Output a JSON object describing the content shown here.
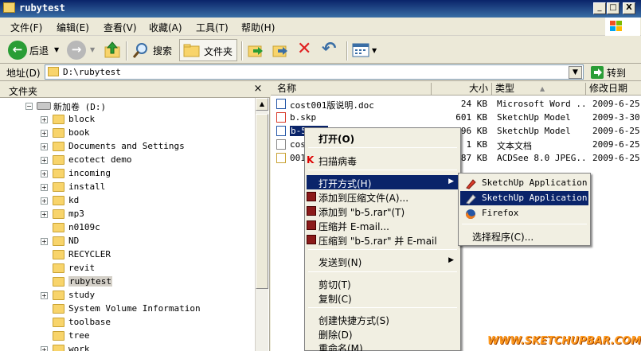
{
  "window": {
    "title": "rubytest",
    "controls": {
      "minimize": "_",
      "maximize": "□",
      "close": "X"
    }
  },
  "menubar": {
    "items": [
      "文件(F)",
      "编辑(E)",
      "查看(V)",
      "收藏(A)",
      "工具(T)",
      "帮助(H)"
    ]
  },
  "toolbar": {
    "back_label": "后退",
    "search_label": "搜索",
    "folders_label": "文件夹"
  },
  "address": {
    "label": "地址(D)",
    "value": "D:\\rubytest",
    "go_label": "转到"
  },
  "folder_pane": {
    "title": "文件夹",
    "close": "×",
    "root": "新加卷 (D:)",
    "folders": [
      {
        "name": "block",
        "expandable": true
      },
      {
        "name": "book",
        "expandable": true
      },
      {
        "name": "Documents and Settings",
        "expandable": true
      },
      {
        "name": "ecotect demo",
        "expandable": true
      },
      {
        "name": "incoming",
        "expandable": true
      },
      {
        "name": "install",
        "expandable": true
      },
      {
        "name": "kd",
        "expandable": true
      },
      {
        "name": "mp3",
        "expandable": true
      },
      {
        "name": "n0109c",
        "expandable": false
      },
      {
        "name": "ND",
        "expandable": true
      },
      {
        "name": "RECYCLER",
        "expandable": false
      },
      {
        "name": "revit",
        "expandable": false
      },
      {
        "name": "rubytest",
        "expandable": false,
        "selected": true
      },
      {
        "name": "study",
        "expandable": true
      },
      {
        "name": "System Volume Information",
        "expandable": false
      },
      {
        "name": "toolbase",
        "expandable": false
      },
      {
        "name": "tree",
        "expandable": false
      },
      {
        "name": "work",
        "expandable": true
      }
    ]
  },
  "file_list": {
    "columns": {
      "name": "名称",
      "size": "大小",
      "type": "类型",
      "modified": "修改日期"
    },
    "rows": [
      {
        "name": "cost001版说明.doc",
        "size": "24 KB",
        "type": "Microsoft Word ...",
        "modified": "2009-6-25"
      },
      {
        "name": "b.skp",
        "size": "601 KB",
        "type": "SketchUp Model",
        "modified": "2009-3-30"
      },
      {
        "name": "b-5.skp",
        "size": "596 KB",
        "type": "SketchUp Model",
        "modified": "2009-6-25",
        "selected": true
      },
      {
        "name": "cost",
        "size": "1 KB",
        "type": "文本文档",
        "modified": "2009-6-25"
      },
      {
        "name": "001",
        "size": "87 KB",
        "type": "ACDSee 8.0 JPEG...",
        "modified": "2009-6-25"
      }
    ]
  },
  "context_menu": {
    "items": [
      {
        "label": "打开(O)",
        "bold": true
      },
      {
        "label": "扫描病毒"
      },
      {
        "label": "打开方式(H)",
        "submenu": true,
        "highlighted": true
      },
      {
        "label": "添加到压缩文件(A)..."
      },
      {
        "label": "添加到 \"b-5.rar\"(T)"
      },
      {
        "label": "压缩并 E-mail..."
      },
      {
        "label": "压缩到 \"b-5.rar\" 并 E-mail"
      },
      {
        "label": "发送到(N)",
        "submenu": true
      },
      {
        "label": "剪切(T)"
      },
      {
        "label": "复制(C)"
      },
      {
        "label": "创建快捷方式(S)"
      },
      {
        "label": "删除(D)"
      },
      {
        "label": "重命名(M)"
      }
    ]
  },
  "open_with_menu": {
    "items": [
      {
        "label": "SketchUp Application"
      },
      {
        "label": "SketchUp Application",
        "highlighted": true
      },
      {
        "label": "Firefox"
      },
      {
        "label": "选择程序(C)..."
      }
    ]
  },
  "watermark": "WWW.SKETCHUPBAR.COM",
  "colors": {
    "highlight": "#0a246a",
    "titlebar": "#0a246a",
    "menu_bg": "#f1efe2",
    "watermark": "#ff9a1e"
  }
}
